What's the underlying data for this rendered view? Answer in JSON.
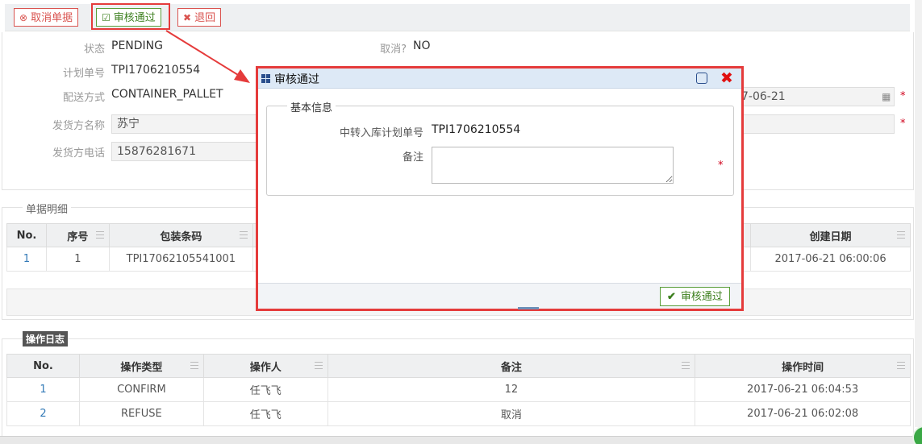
{
  "toolbar": {
    "cancel_label": "取消单据",
    "approve_label": "审核通过",
    "return_label": "退回"
  },
  "form": {
    "status_label": "状态",
    "status_value": "PENDING",
    "cancelled_label": "取消?",
    "cancelled_value": "NO",
    "plan_no_label": "计划单号",
    "plan_no_value": "TPI1706210554",
    "delivery_label": "配送方式",
    "delivery_value": "CONTAINER_PALLET",
    "date_partial": "7-06-21",
    "shipper_name_label": "发货方名称",
    "shipper_name_value": "苏宁",
    "shipper_phone_label": "发货方电话",
    "shipper_phone_value": "15876281671",
    "required_mark": "*"
  },
  "details": {
    "legend": "单据明细",
    "columns": [
      "No.",
      "序号",
      "包装条码",
      "创建日期"
    ],
    "rows": [
      {
        "no": "1",
        "seq": "1",
        "barcode": "TPI17062105541001",
        "created": "2017-06-21 06:00:06"
      }
    ]
  },
  "log": {
    "legend": "操作日志",
    "columns": [
      "No.",
      "操作类型",
      "操作人",
      "备注",
      "操作时间"
    ],
    "rows": [
      {
        "no": "1",
        "type": "CONFIRM",
        "operator": "任飞飞",
        "remark": "12",
        "time": "2017-06-21 06:04:53"
      },
      {
        "no": "2",
        "type": "REFUSE",
        "operator": "任飞飞",
        "remark": "取消",
        "time": "2017-06-21 06:02:08"
      }
    ]
  },
  "modal": {
    "title": "审核通过",
    "legend": "基本信息",
    "plan_label": "中转入库计划单号",
    "plan_value": "TPI1706210554",
    "remark_label": "备注",
    "remark_value": "",
    "required_mark": "*",
    "ok_label": "审核通过"
  },
  "colors": {
    "highlight": "#e53b3b",
    "danger": "#d9534f",
    "success": "#3c7f1e",
    "modal_header": "#dde9f6"
  }
}
